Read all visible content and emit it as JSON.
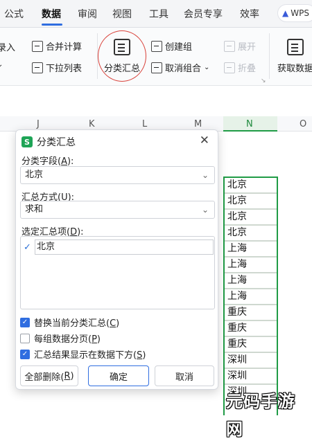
{
  "menu": {
    "items": [
      "公式",
      "数据",
      "审阅",
      "视图",
      "工具",
      "会员专享",
      "效率"
    ],
    "active": "数据",
    "wps_label": "WPS"
  },
  "ribbon": {
    "record_label": "录入",
    "merge_calc": "合并计算",
    "dropdown_list": "下拉列表",
    "subtotal": "分类汇总",
    "create_group": "创建组",
    "ungroup": "取消组合",
    "expand": "展开",
    "collapse": "折叠",
    "get_data": "获取数据"
  },
  "columns": [
    "J",
    "K",
    "L",
    "M",
    "N",
    "O"
  ],
  "selected_column": "N",
  "cells": [
    "北京",
    "北京",
    "北京",
    "北京",
    "上海",
    "上海",
    "上海",
    "上海",
    "重庆",
    "重庆",
    "重庆",
    "深圳",
    "深圳",
    "深圳"
  ],
  "dialog": {
    "title": "分类汇总",
    "field_label_pre": "分类字段(",
    "field_label_key": "A",
    "field_label_post": "):",
    "field_value": "北京",
    "method_label_pre": "汇总方式(",
    "method_label_key": "U",
    "method_label_post": "):",
    "method_value": "求和",
    "items_label_pre": "选定汇总项(",
    "items_label_key": "D",
    "items_label_post": "):",
    "list_items": [
      {
        "label": "北京",
        "checked": true
      }
    ],
    "options": [
      {
        "pre": "替换当前分类汇总(",
        "key": "C",
        "post": ")",
        "checked": true
      },
      {
        "pre": "每组数据分页(",
        "key": "P",
        "post": ")",
        "checked": false
      },
      {
        "pre": "汇总结果显示在数据下方(",
        "key": "S",
        "post": ")",
        "checked": true
      }
    ],
    "remove_all_pre": "全部删除(",
    "remove_all_key": "R",
    "remove_all_post": ")",
    "ok": "确定",
    "cancel": "取消"
  },
  "colors": {
    "accent": "#2f6de0",
    "green": "#1f9b45",
    "red_circle": "#d9413a"
  },
  "watermark": "元码手游网"
}
